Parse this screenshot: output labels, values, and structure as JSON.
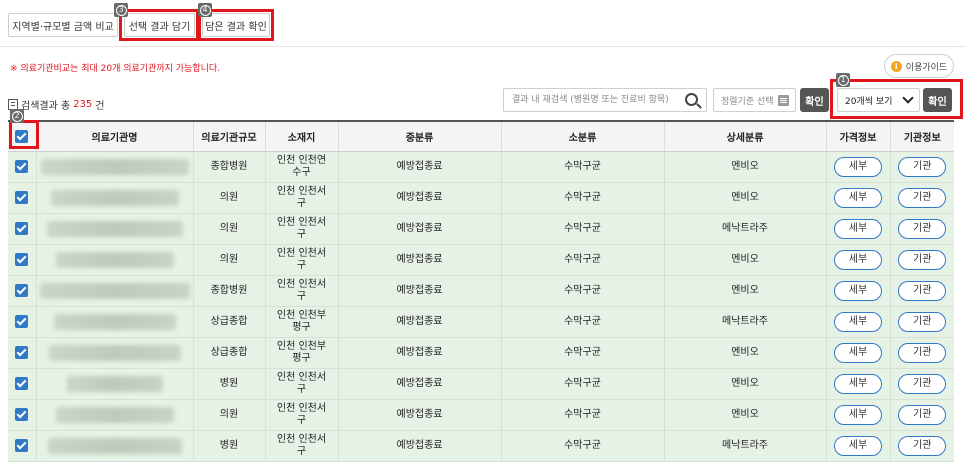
{
  "top_buttons": {
    "region_compare": "지역별·규모별 금액 비교",
    "add_selected": "선택 결과 담기",
    "view_added": "담은 결과 확인"
  },
  "markers": {
    "m1": "1",
    "m2": "2",
    "m3": "3",
    "m4": "4"
  },
  "guide_button": {
    "icon": "i",
    "label": "이용가이드"
  },
  "notice": "※ 의료기관비교는 최대 20개 의료기관까지 가능합니다.",
  "results": {
    "prefix": "검색결과 총",
    "count": "235",
    "suffix": "건"
  },
  "search": {
    "placeholder": "결과 내 재검색 (병원명 또는 진료비 항목)"
  },
  "sort": {
    "label": "정렬기준 선택"
  },
  "confirm_label": "확인",
  "view_count": {
    "selected": "20개씩 보기"
  },
  "columns": [
    "의료기관명",
    "의료기관규모",
    "소재지",
    "중분류",
    "소분류",
    "상세분류",
    "가격정보",
    "기관정보"
  ],
  "row_buttons": {
    "price": "세부",
    "institution": "기관"
  },
  "rows": [
    {
      "size": "종합병원",
      "loc1": "인천 인천연",
      "loc2": "수구",
      "mid": "예방접종료",
      "small": "수막구균",
      "detail": "멘비오"
    },
    {
      "size": "의원",
      "loc1": "인천 인천서",
      "loc2": "구",
      "mid": "예방접종료",
      "small": "수막구균",
      "detail": "멘비오"
    },
    {
      "size": "의원",
      "loc1": "인천 인천서",
      "loc2": "구",
      "mid": "예방접종료",
      "small": "수막구균",
      "detail": "메낙트라주"
    },
    {
      "size": "의원",
      "loc1": "인천 인천서",
      "loc2": "구",
      "mid": "예방접종료",
      "small": "수막구균",
      "detail": "멘비오"
    },
    {
      "size": "종합병원",
      "loc1": "인천 인천서",
      "loc2": "구",
      "mid": "예방접종료",
      "small": "수막구균",
      "detail": "멘비오"
    },
    {
      "size": "상급종합",
      "loc1": "인천 인천부",
      "loc2": "평구",
      "mid": "예방접종료",
      "small": "수막구균",
      "detail": "메낙트라주"
    },
    {
      "size": "상급종합",
      "loc1": "인천 인천부",
      "loc2": "평구",
      "mid": "예방접종료",
      "small": "수막구균",
      "detail": "멘비오"
    },
    {
      "size": "병원",
      "loc1": "인천 인천서",
      "loc2": "구",
      "mid": "예방접종료",
      "small": "수막구균",
      "detail": "멘비오"
    },
    {
      "size": "의원",
      "loc1": "인천 인천서",
      "loc2": "구",
      "mid": "예방접종료",
      "small": "수막구균",
      "detail": "멘비오"
    },
    {
      "size": "병원",
      "loc1": "인천 인천서",
      "loc2": "구",
      "mid": "예방접종료",
      "small": "수막구균",
      "detail": "메낙트라주"
    }
  ]
}
